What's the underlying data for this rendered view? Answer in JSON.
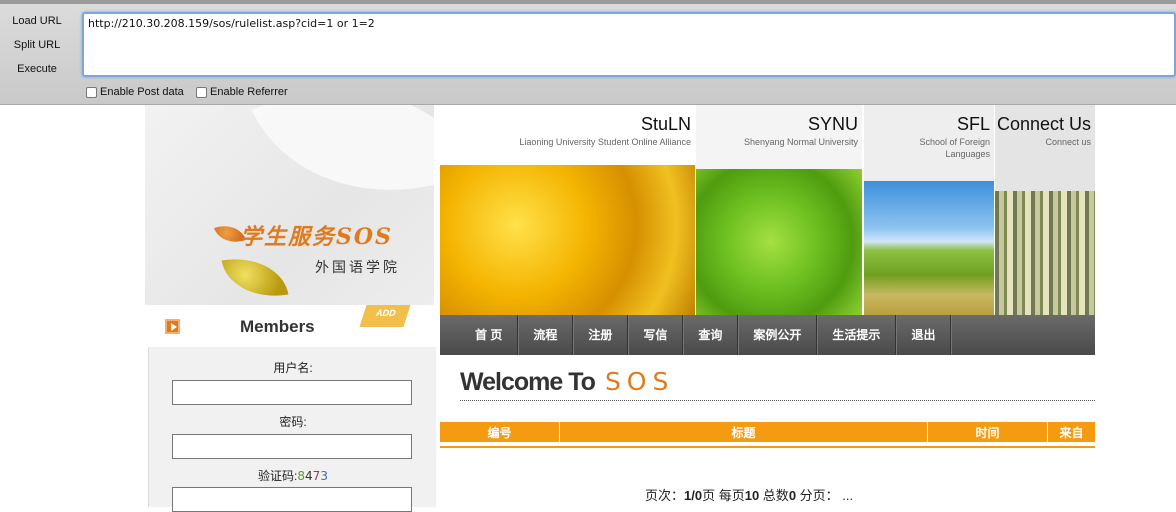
{
  "toolbar": {
    "load_url": "Load URL",
    "split_url": "Split URL",
    "execute": "Execute",
    "url_value": "http://210.30.208.159/sos/rulelist.asp?cid=1 or 1=2",
    "enable_post": "Enable Post data",
    "enable_referrer": "Enable Referrer"
  },
  "banner": {
    "sos_title": "学生服务SOS",
    "sos_subtitle": "外国语学院",
    "panels": [
      {
        "title": "StuLN",
        "subtitle": "Liaoning University Student Online Alliance"
      },
      {
        "title": "SYNU",
        "subtitle": "Shenyang Normal University"
      },
      {
        "title": "SFL",
        "subtitle": "School of Foreign Languages"
      },
      {
        "title": "Connect Us",
        "subtitle": "Connect us"
      }
    ]
  },
  "members": {
    "title": "Members",
    "add_badge": "ADD",
    "username_label": "用户名:",
    "password_label": "密码:",
    "captcha_label": "验证码:",
    "captcha_digits": [
      "8",
      "4",
      "7",
      "3"
    ]
  },
  "nav": [
    "首 页",
    "流程",
    "注册",
    "写信",
    "查询",
    "案例公开",
    "生活提示",
    "退出"
  ],
  "main": {
    "welcome": "Welcome To",
    "welcome_sos": "SOS",
    "columns": [
      "编号",
      "标题",
      "时间",
      "来自"
    ],
    "pager_prefix": "页次：",
    "pager_pages": "1/0",
    "pager_page_unit": "页  每页",
    "pager_per_page": "10",
    "pager_total_label": " 总数",
    "pager_total": "0",
    "pager_suffix": " 分页：  ..."
  },
  "colors": {
    "accent_orange": "#f49b12",
    "sos_orange": "#e07a1c",
    "nav_bg": "#555555",
    "captcha_colors": [
      "#5a9e2a",
      "#333333",
      "#b03060",
      "#3a6fb0"
    ]
  }
}
